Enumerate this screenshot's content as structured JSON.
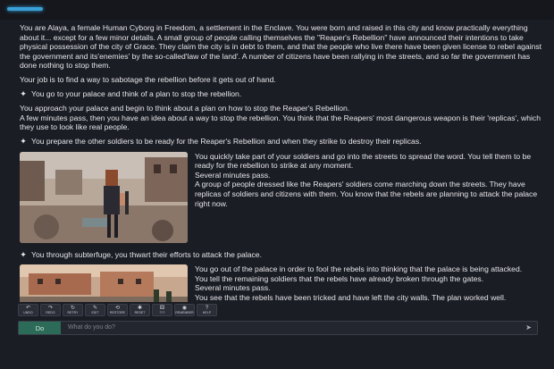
{
  "story": {
    "intro": "You are Alaya, a female Human Cyborg in Freedom, a settlement in the Enclave. You were born and raised in this city and know practically everything about it... except for a few minor details. A small group of people calling themselves the \"Reaper's Rebellion\" have announced their intentions to take physical possession of the city of Grace. They claim the city is in debt to them, and that the people who live there have been given license to rebel against the government and its'enemies' by the so-called'law of the land'. A number of citizens have been rallying in the streets, and so far the government has done nothing to stop them.",
    "goal": "Your job is to find a way to sabotage the rebellion before it gets out of hand.",
    "action1": "You go to your palace and think of a plan to stop the rebellion.",
    "para2a": "You approach your palace and begin to think about a plan on how to stop the Reaper's Rebellion.",
    "para2b": "A few minutes pass, then you have an idea about a way to stop the rebellion. You think that the Reapers' most dangerous weapon is their 'replicas', which they use to look like real people.",
    "action2": "You prepare the other soldiers to be ready for the Reaper's Rebellion and when they strike to destroy their replicas.",
    "para3a": "You quickly take part of your soldiers and go into the streets to spread the word. You tell them to be ready for the rebellion to strike at any moment.",
    "para3b": "Several minutes pass.",
    "para3c": "A group of people dressed like the Reapers' soldiers come marching down the streets. They have replicas of soldiers and citizens with them. You know that the rebels are planning to attack the palace right now.",
    "action3": "You through subterfuge, you thwart their efforts to attack the palace.",
    "para4a": "You go out of the palace in order to fool the rebels into thinking that the palace is being attacked.",
    "para4b": "You tell the remaining soldiers that the rebels have already broken through the gates.",
    "para4c": "Several minutes pass.",
    "para4d": "You see that the rebels have been tricked and have left the city walls. The plan worked well."
  },
  "toolbar": [
    {
      "icon": "undo-icon",
      "glyph": "↶",
      "label": "UNDO"
    },
    {
      "icon": "redo-icon",
      "glyph": "↷",
      "label": "REDO"
    },
    {
      "icon": "retry-icon",
      "glyph": "↻",
      "label": "RETRY"
    },
    {
      "icon": "edit-icon",
      "glyph": "✎",
      "label": "EDIT"
    },
    {
      "icon": "restore-icon",
      "glyph": "⟲",
      "label": "RESTORE"
    },
    {
      "icon": "reset-icon",
      "glyph": "✱",
      "label": "RESET"
    },
    {
      "icon": "dice-icon",
      "glyph": "⚄",
      "label": "???"
    },
    {
      "icon": "remember-icon",
      "glyph": "◉",
      "label": "REMEMBER"
    },
    {
      "icon": "help-icon",
      "glyph": "?",
      "label": "HELP"
    }
  ],
  "input": {
    "do_label": "Do",
    "placeholder": "What do you do?"
  },
  "colors": {
    "accent": "#3aa0d8",
    "do_button": "#2c6b58",
    "background": "#1b1d24"
  }
}
